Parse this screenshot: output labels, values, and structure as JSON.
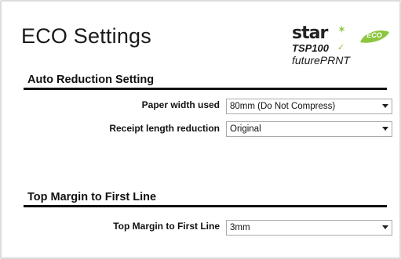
{
  "page": {
    "title": "ECO Settings"
  },
  "logo": {
    "brand_wordmark": "star",
    "eco_badge": "ECO",
    "model": "TSP100",
    "product_line": "futurePRNT",
    "colors": {
      "eco_green": "#8cc63f",
      "text": "#1a1a1a"
    }
  },
  "auto_reduction": {
    "heading": "Auto Reduction Setting",
    "paper_width": {
      "label": "Paper width used",
      "value": "80mm (Do Not Compress)"
    },
    "receipt_length": {
      "label": "Receipt length reduction",
      "value": "Original"
    }
  },
  "top_margin": {
    "heading": "Top Margin to First Line",
    "field": {
      "label": "Top Margin to First Line",
      "value": "3mm"
    }
  },
  "icons": {
    "dropdown": "chevron-down-icon",
    "logo_spark": "spark-icon",
    "logo_leaf": "leaf-icon"
  }
}
